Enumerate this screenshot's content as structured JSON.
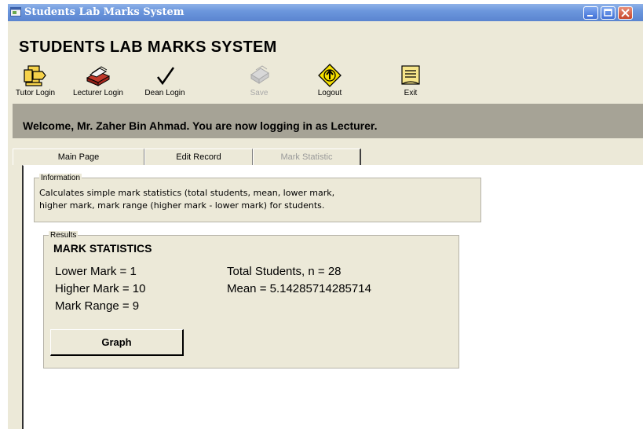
{
  "window": {
    "title": "Students Lab Marks System"
  },
  "app": {
    "heading": "STUDENTS LAB MARKS SYSTEM"
  },
  "toolbar": {
    "items": [
      {
        "label": "Tutor Login",
        "icon": "tutor-login-icon"
      },
      {
        "label": "Lecturer Login",
        "icon": "lecturer-login-icon"
      },
      {
        "label": "Dean Login",
        "icon": "checkmark-icon"
      },
      {
        "label": "Save",
        "icon": "save-icon",
        "disabled": true
      },
      {
        "label": "Logout",
        "icon": "logout-icon"
      },
      {
        "label": "Exit",
        "icon": "exit-icon"
      }
    ]
  },
  "welcome": {
    "text": "Welcome, Mr. Zaher Bin Ahmad. You are now logging in as Lecturer."
  },
  "tabs": [
    {
      "label": "Main Page"
    },
    {
      "label": "Edit Record"
    },
    {
      "label": "Mark Statistic",
      "active": true
    }
  ],
  "information": {
    "legend": "Information",
    "line1": "Calculates simple mark statistics (total students, mean, lower mark,",
    "line2": "higher mark, mark range (higher mark - lower mark) for students."
  },
  "results": {
    "legend": "Results",
    "title": "MARK STATISTICS",
    "lower_mark": "Lower Mark = 1",
    "higher_mark": "Higher Mark = 10",
    "mark_range": "Mark Range = 9",
    "total_students": "Total Students, n = 28",
    "mean": "Mean = 5.14285714285714",
    "graph_button": "Graph"
  },
  "colors": {
    "titlebar": "#6c97dd",
    "window_bg": "#ece9d8",
    "welcome_band": "#a6a396"
  }
}
